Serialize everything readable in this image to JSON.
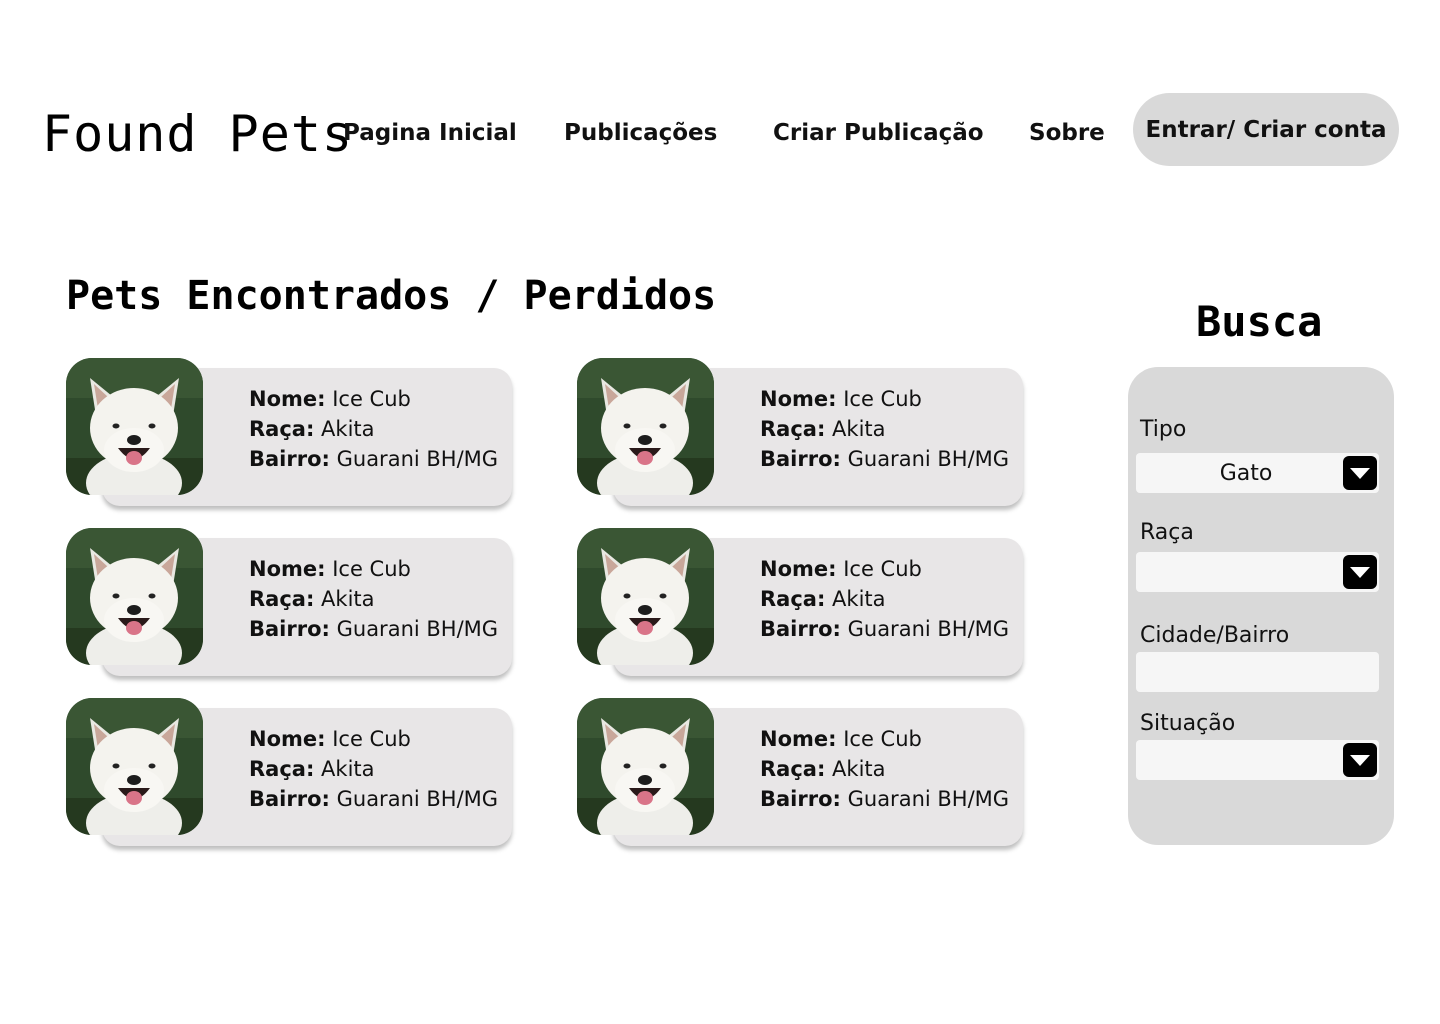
{
  "header": {
    "logo": "Found Pets",
    "nav": {
      "home": "Pagina Inicial",
      "publications": "Publicações",
      "create": "Criar Publicação",
      "about": "Sobre"
    },
    "login_label": "Entrar/ Criar conta"
  },
  "main": {
    "title": "Pets Encontrados / Perdidos",
    "labels": {
      "name": "Nome:",
      "breed": "Raça:",
      "district": "Bairro:"
    },
    "pets": [
      {
        "name": "Ice Cub",
        "breed": "Akita",
        "district": "Guarani BH/MG"
      },
      {
        "name": "Ice Cub",
        "breed": "Akita",
        "district": "Guarani BH/MG"
      },
      {
        "name": "Ice Cub",
        "breed": "Akita",
        "district": "Guarani BH/MG"
      },
      {
        "name": "Ice Cub",
        "breed": "Akita",
        "district": "Guarani BH/MG"
      },
      {
        "name": "Ice Cub",
        "breed": "Akita",
        "district": "Guarani BH/MG"
      },
      {
        "name": "Ice Cub",
        "breed": "Akita",
        "district": "Guarani BH/MG"
      }
    ]
  },
  "search": {
    "title": "Busca",
    "type_label": "Tipo",
    "type_value": "Gato",
    "breed_label": "Raça",
    "breed_value": "",
    "city_label": "Cidade/Bairro",
    "city_value": "",
    "status_label": "Situação",
    "status_value": ""
  },
  "icons": {
    "dropdown": "caret-down-icon",
    "pet_photo": "white-akita-dog-photo"
  },
  "colors": {
    "card_bg": "#e8e6e7",
    "panel_bg": "#d9d9d9",
    "button_bg": "#d9d9d9",
    "input_bg": "#f6f6f6",
    "photo_grass": "#2f4a2c"
  }
}
